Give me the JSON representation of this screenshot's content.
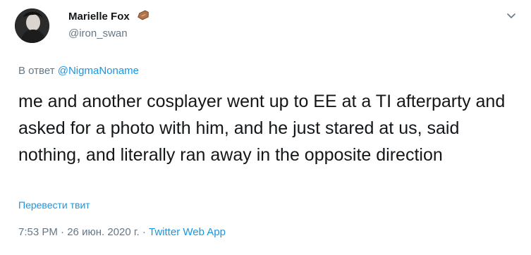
{
  "author": {
    "display_name": "Marielle Fox",
    "name_emoji": "coffin-emoji",
    "handle": "@iron_swan"
  },
  "reply": {
    "prefix": "В ответ",
    "mention": "@NigmaNoname"
  },
  "tweet": {
    "text": "me and another cosplayer went up to EE at a TI afterparty and asked for a photo with him, and he just stared at us, said nothing, and literally ran away in the opposite direction"
  },
  "translate_label": "Перевести твит",
  "meta": {
    "time": "7:53 PM",
    "sep1": " · ",
    "date": "26 июн. 2020 г.",
    "sep2": " · ",
    "app": "Twitter Web App"
  },
  "colors": {
    "link": "#1b95e0",
    "secondary": "#657786",
    "text": "#14171a"
  }
}
